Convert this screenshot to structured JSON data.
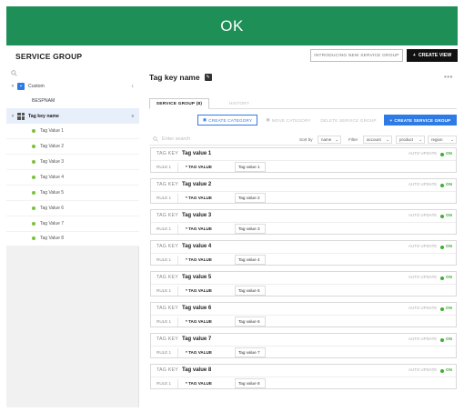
{
  "banner": {
    "text": "OK",
    "color": "#1e8f57"
  },
  "header": {
    "title": "SERVICE GROUP",
    "intro_button": "INTRODUCING NEW SERVICE GROUP",
    "create_view": "CREATE VIEW"
  },
  "sidebar": {
    "search_icon": "search-icon",
    "custom": {
      "label": "Custom",
      "count": "1",
      "child": "BESPNAM"
    },
    "tag_key": {
      "label": "Tag key name",
      "count": "8"
    },
    "values": [
      "Tag Value 1",
      "Tag Value 2",
      "Tag Value 3",
      "Tag Value 4",
      "Tag Value 5",
      "Tag Value 6",
      "Tag Value 7",
      "Tag Value 8"
    ]
  },
  "main": {
    "title": "Tag key name",
    "tabs": [
      {
        "label": "SERVICE GROUP (8)",
        "active": true
      },
      {
        "label": "HISTORY",
        "active": false
      }
    ],
    "actions": {
      "create_category": "CREATE CATEGORY",
      "move_category": "MOVE CATEGORY",
      "delete_service_group": "DELETE SERVICE GROUP",
      "create_service_group": "CREATE SERVICE GROUP"
    },
    "filter": {
      "search_placeholder": "Enter search",
      "sort_by_label": "Sort by",
      "sort_value": "name",
      "filter_label": "Filter",
      "filter_values": [
        "account",
        "product",
        "region"
      ]
    },
    "card_labels": {
      "tag_key": "TAG KEY",
      "auto_update": "AUTO UPDATE",
      "on": "ON",
      "rule": "RULE 1",
      "tag_value": "* TAG VALUE"
    },
    "cards": [
      {
        "title": "Tag value 1",
        "value": "Tag value 1"
      },
      {
        "title": "Tag value 2",
        "value": "Tag value 2"
      },
      {
        "title": "Tag value 3",
        "value": "Tag value 3"
      },
      {
        "title": "Tag value 4",
        "value": "Tag value 4"
      },
      {
        "title": "Tag value 5",
        "value": "Tag value 5"
      },
      {
        "title": "Tag value 6",
        "value": "Tag value 6"
      },
      {
        "title": "Tag value 7",
        "value": "Tag value 7"
      },
      {
        "title": "Tag value 8",
        "value": "Tag value 8"
      }
    ]
  },
  "colors": {
    "accent": "#2f7be6",
    "on_green": "#3fae34",
    "dot_green": "#7ac23b"
  }
}
